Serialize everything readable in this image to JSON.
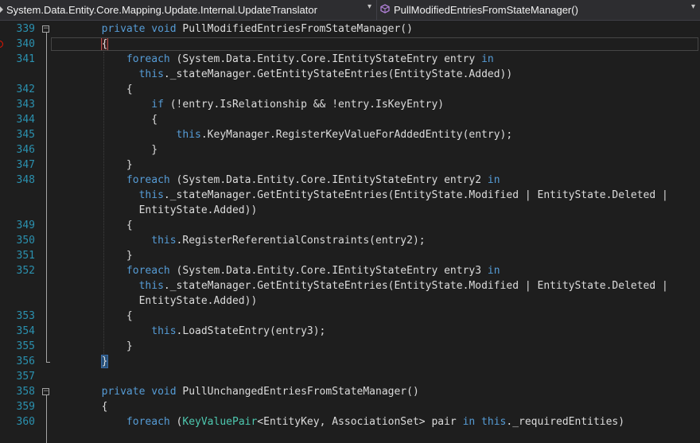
{
  "navbar": {
    "type_selector": "System.Data.Entity.Core.Mapping.Update.Internal.UpdateTranslator",
    "member_selector": "PullModifiedEntriesFromStateManager()",
    "dropdown_glyph": "▾"
  },
  "code_lines": [
    {
      "num": "339",
      "tokens": [
        [
          "kw",
          "private void "
        ],
        [
          "p",
          "PullModifiedEntriesFromStateManager()"
        ]
      ]
    },
    {
      "num": "340",
      "tokens": [
        [
          "brace",
          "{"
        ]
      ]
    },
    {
      "num": "341",
      "tokens": [
        [
          "kw",
          "    foreach "
        ],
        [
          "p",
          "(System.Data.Entity.Core.IEntityStateEntry entry "
        ],
        [
          "kw",
          "in"
        ]
      ]
    },
    {
      "num": "",
      "tokens": [
        [
          "kw",
          "      this"
        ],
        [
          "p",
          "._stateManager.GetEntityStateEntries(EntityState.Added))"
        ]
      ]
    },
    {
      "num": "342",
      "tokens": [
        [
          "p",
          "    {"
        ]
      ]
    },
    {
      "num": "343",
      "tokens": [
        [
          "kw",
          "        if "
        ],
        [
          "p",
          "(!entry.IsRelationship && !entry.IsKeyEntry)"
        ]
      ]
    },
    {
      "num": "344",
      "tokens": [
        [
          "p",
          "        {"
        ]
      ]
    },
    {
      "num": "345",
      "tokens": [
        [
          "kw",
          "            this"
        ],
        [
          "p",
          ".KeyManager.RegisterKeyValueForAddedEntity(entry);"
        ]
      ]
    },
    {
      "num": "346",
      "tokens": [
        [
          "p",
          "        }"
        ]
      ]
    },
    {
      "num": "347",
      "tokens": [
        [
          "p",
          "    }"
        ]
      ]
    },
    {
      "num": "348",
      "tokens": [
        [
          "kw",
          "    foreach "
        ],
        [
          "p",
          "(System.Data.Entity.Core.IEntityStateEntry entry2 "
        ],
        [
          "kw",
          "in"
        ]
      ]
    },
    {
      "num": "",
      "tokens": [
        [
          "kw",
          "      this"
        ],
        [
          "p",
          "._stateManager.GetEntityStateEntries(EntityState.Modified | EntityState.Deleted |"
        ]
      ]
    },
    {
      "num": "",
      "tokens": [
        [
          "p",
          "      EntityState.Added))"
        ]
      ]
    },
    {
      "num": "349",
      "tokens": [
        [
          "p",
          "    {"
        ]
      ]
    },
    {
      "num": "350",
      "tokens": [
        [
          "kw",
          "        this"
        ],
        [
          "p",
          ".RegisterReferentialConstraints(entry2);"
        ]
      ]
    },
    {
      "num": "351",
      "tokens": [
        [
          "p",
          "    }"
        ]
      ]
    },
    {
      "num": "352",
      "tokens": [
        [
          "kw",
          "    foreach "
        ],
        [
          "p",
          "(System.Data.Entity.Core.IEntityStateEntry entry3 "
        ],
        [
          "kw",
          "in"
        ]
      ]
    },
    {
      "num": "",
      "tokens": [
        [
          "kw",
          "      this"
        ],
        [
          "p",
          "._stateManager.GetEntityStateEntries(EntityState.Modified | EntityState.Deleted |"
        ]
      ]
    },
    {
      "num": "",
      "tokens": [
        [
          "p",
          "      EntityState.Added))"
        ]
      ]
    },
    {
      "num": "353",
      "tokens": [
        [
          "p",
          "    {"
        ]
      ]
    },
    {
      "num": "354",
      "tokens": [
        [
          "kw",
          "        this"
        ],
        [
          "p",
          ".LoadStateEntry(entry3);"
        ]
      ]
    },
    {
      "num": "355",
      "tokens": [
        [
          "p",
          "    }"
        ]
      ]
    },
    {
      "num": "356",
      "tokens": [
        [
          "hl",
          "}"
        ]
      ]
    },
    {
      "num": "357",
      "tokens": []
    },
    {
      "num": "358",
      "tokens": [
        [
          "kw",
          "private void "
        ],
        [
          "p",
          "PullUnchangedEntriesFromStateManager()"
        ]
      ]
    },
    {
      "num": "359",
      "tokens": [
        [
          "p",
          "{"
        ]
      ]
    },
    {
      "num": "360",
      "tokens": [
        [
          "kw",
          "    foreach "
        ],
        [
          "p",
          "("
        ],
        [
          "ty",
          "KeyValuePair"
        ],
        [
          "p",
          "<EntityKey, AssociationSet> pair "
        ],
        [
          "kw",
          "in this"
        ],
        [
          "p",
          "._requiredEntities)"
        ]
      ]
    }
  ],
  "colors": {
    "background": "#1e1e1e",
    "keyword": "#569cd6",
    "type": "#4ec9b0",
    "plain": "#dcdcdc",
    "line_number": "#2b91af",
    "breakpoint": "#e51400"
  }
}
